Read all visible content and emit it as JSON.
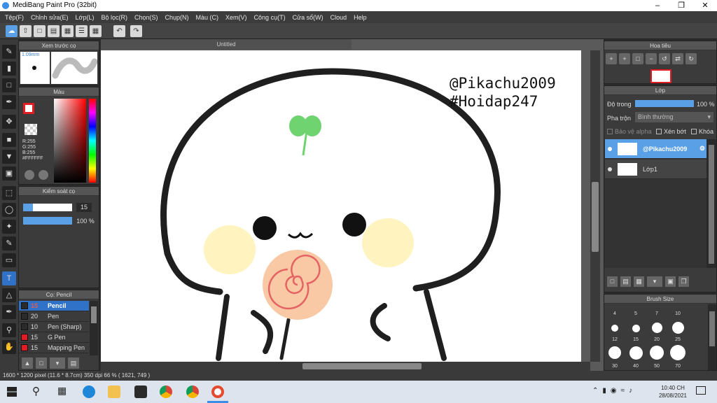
{
  "window": {
    "title": "MediBang Paint Pro (32bit)"
  },
  "menu": [
    "Tệp(F)",
    "Chỉnh sửa(E)",
    "Lớp(L)",
    "Bộ lọc(R)",
    "Chọn(S)",
    "Chụp(N)",
    "Màu (C)",
    "Xem(V)",
    "Công cụ(T)",
    "Cửa sổ(W)",
    "Cloud",
    "Help"
  ],
  "brush_preview": {
    "title": "Xem trước cọ",
    "size": "1.09mm"
  },
  "color_panel": {
    "title": "Màu",
    "r": "R:255",
    "g": "G:255",
    "b": "B:255",
    "hex": "#FFFFFF",
    "primary": "#e31b23"
  },
  "brush_control": {
    "title": "Kiểm soát cọ",
    "size": "15",
    "opacity": "100 %",
    "size_fraction": 0.2,
    "opacity_fraction": 1.0
  },
  "brush_list": {
    "title": "Cọ: Pencil",
    "items": [
      {
        "size": "15",
        "name": "Pencil",
        "color": "#2b2b2b",
        "selected": true
      },
      {
        "size": "20",
        "name": "Pen",
        "color": "#2b2b2b",
        "selected": false
      },
      {
        "size": "10",
        "name": "Pen (Sharp)",
        "color": "#2b2b2b",
        "selected": false
      },
      {
        "size": "15",
        "name": "G Pen",
        "color": "#e31b23",
        "selected": false
      },
      {
        "size": "15",
        "name": "Mapping Pen",
        "color": "#e31b23",
        "selected": false
      }
    ]
  },
  "document": {
    "tab": "Untitled"
  },
  "canvas_text": {
    "line1": "@Pikachu2009",
    "line2": "#Hoidap247"
  },
  "navigator": {
    "title": "Hoa tiêu"
  },
  "layer_panel": {
    "title": "Lớp",
    "opacity_label": "Độ trong",
    "opacity_value": "100 %",
    "blend_label": "Pha trộn",
    "blend_value": "Bình thường",
    "protect_alpha": "Bảo vệ alpha",
    "clipping": "Xén bớt",
    "lock": "Khóa",
    "layers": [
      {
        "name": "@Pikachu2009",
        "selected": true
      },
      {
        "name": "Lớp1",
        "selected": false
      }
    ]
  },
  "brush_size": {
    "title": "Brush Size",
    "sizes": [
      "4",
      "5",
      "7",
      "10",
      "12",
      "15",
      "20",
      "25",
      "30",
      "40",
      "50",
      "70"
    ]
  },
  "status": {
    "text": "1600 * 1200 pixel   (11.6 * 8.7cm)   350 dpi   66 %   ( 1621, 749 )"
  },
  "taskbar": {
    "time": "10:40 CH",
    "date": "28/08/2021"
  }
}
